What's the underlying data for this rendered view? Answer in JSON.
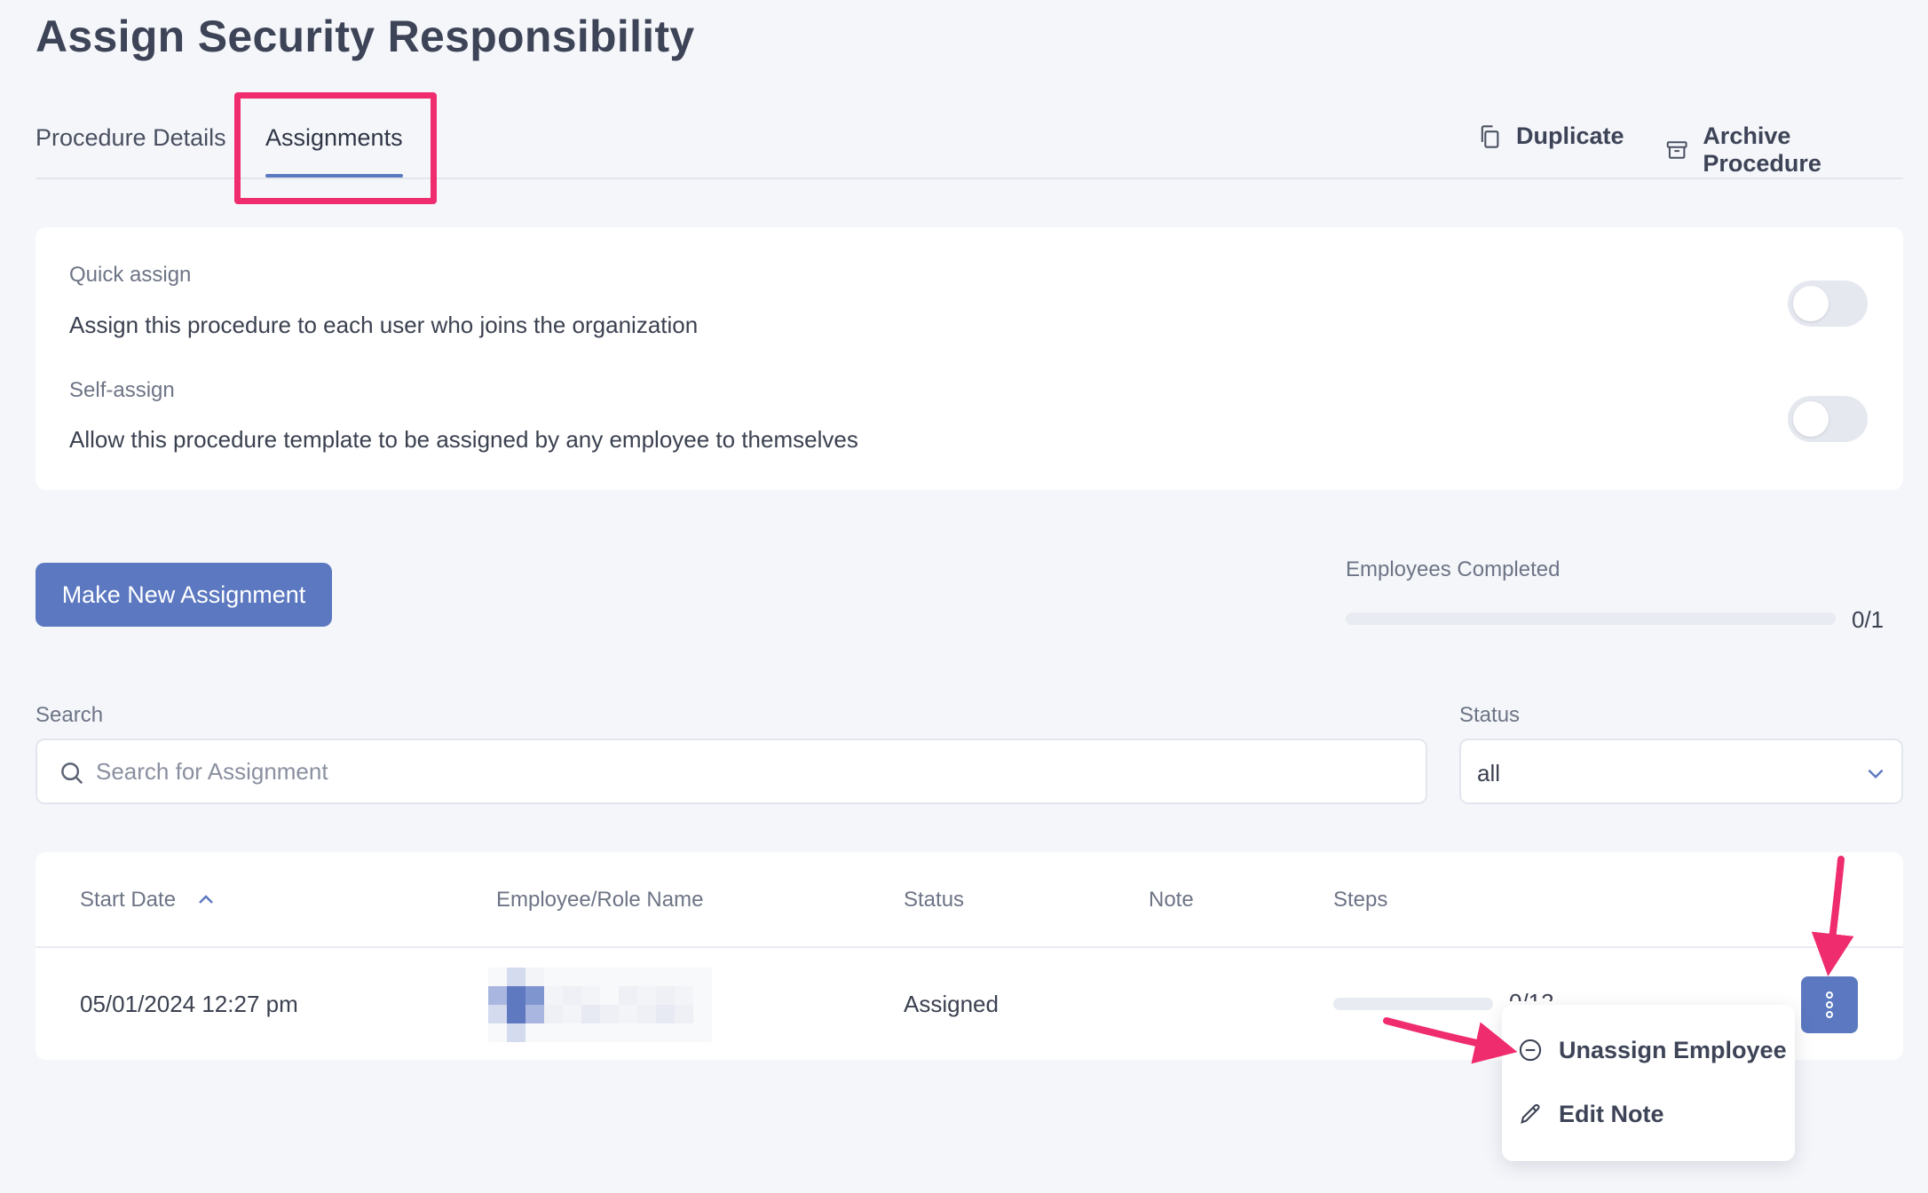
{
  "page": {
    "title": "Assign Security Responsibility"
  },
  "tabs": [
    {
      "label": "Procedure Details"
    },
    {
      "label": "Assignments",
      "active": true
    }
  ],
  "header_actions": {
    "duplicate": {
      "label": "Duplicate",
      "icon": "copy-icon"
    },
    "archive": {
      "label": "Archive Procedure",
      "icon": "archive-icon"
    }
  },
  "settings": {
    "quick_assign": {
      "label": "Quick assign",
      "description": "Assign this procedure to each user who joins the organization",
      "enabled": false
    },
    "self_assign": {
      "label": "Self-assign",
      "description": "Allow this procedure template to be assigned by any employee to themselves",
      "enabled": false
    }
  },
  "actions": {
    "new_assignment_label": "Make New Assignment"
  },
  "completion": {
    "label": "Employees Completed",
    "count": "0/1",
    "fraction": 0
  },
  "filters": {
    "search": {
      "label": "Search",
      "placeholder": "Search for Assignment",
      "value": ""
    },
    "status": {
      "label": "Status",
      "value": "all"
    }
  },
  "table": {
    "columns": {
      "start_date": "Start Date",
      "employee": "Employee/Role Name",
      "status": "Status",
      "note": "Note",
      "steps": "Steps"
    },
    "rows": [
      {
        "start_date": "05/01/2024 12:27 pm",
        "employee_redacted": true,
        "status": "Assigned",
        "note": "",
        "steps_count": "0/12",
        "steps_fraction": 0
      }
    ]
  },
  "row_menu": {
    "items": [
      {
        "label": "Unassign Employee",
        "icon": "minus-circle-icon"
      },
      {
        "label": "Edit Note",
        "icon": "pencil-icon"
      }
    ]
  },
  "colors": {
    "accent": "#5b78c0",
    "highlight": "#ef2c6e",
    "background": "#f4f6fa"
  }
}
